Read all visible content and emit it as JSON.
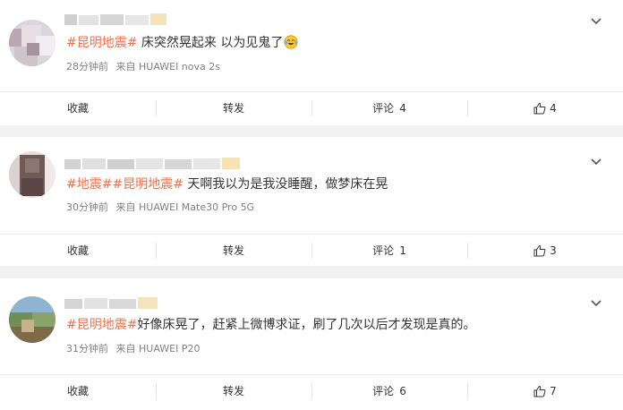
{
  "posts": [
    {
      "hashtags": [
        "#昆明地震#"
      ],
      "text": " 床突然晃起来 以为见鬼了",
      "emoji": "crying-laughing-emoji",
      "time": "28分钟前",
      "source": "来自 HUAWEI nova 2s",
      "actions": {
        "favorite": "收藏",
        "repost": "转发",
        "comment": "评论",
        "comment_count": "4",
        "like_count": "4"
      }
    },
    {
      "hashtags": [
        "#地震#",
        "#昆明地震#"
      ],
      "text": " 天啊我以为是我没睡醒，做梦床在晃",
      "time": "30分钟前",
      "source": "来自 HUAWEI Mate30 Pro 5G",
      "actions": {
        "favorite": "收藏",
        "repost": "转发",
        "comment": "评论",
        "comment_count": "1",
        "like_count": "3"
      }
    },
    {
      "hashtags": [
        "#昆明地震#"
      ],
      "text": "好像床晃了，赶紧上微博求证，刷了几次以后才发现是真的。",
      "time": "31分钟前",
      "source": "来自 HUAWEI P20",
      "actions": {
        "favorite": "收藏",
        "repost": "转发",
        "comment": "评论",
        "comment_count": "6",
        "like_count": "7"
      }
    }
  ],
  "colors": {
    "hashtag": "#eb7350",
    "meta": "#808080",
    "background": "#f2f2f2"
  }
}
